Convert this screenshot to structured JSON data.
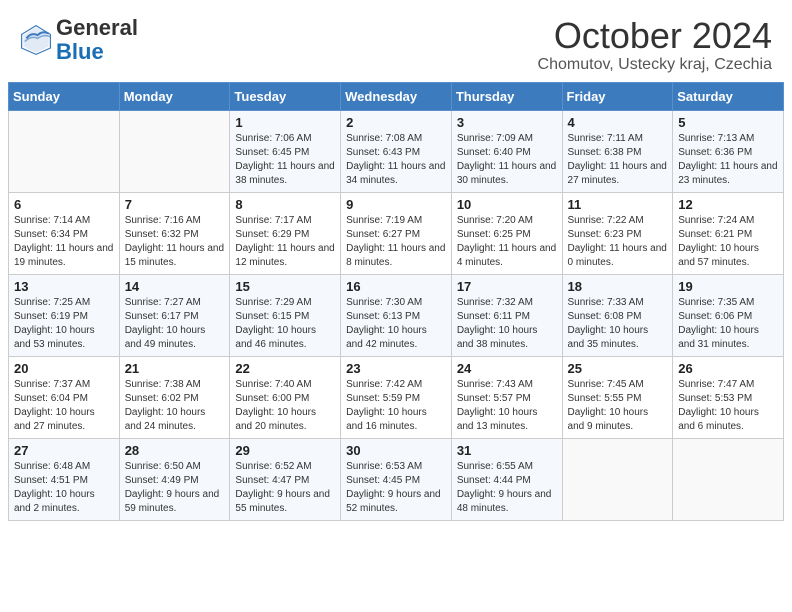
{
  "header": {
    "logo_line1": "General",
    "logo_line2": "Blue",
    "month_title": "October 2024",
    "subtitle": "Chomutov, Ustecky kraj, Czechia"
  },
  "weekdays": [
    "Sunday",
    "Monday",
    "Tuesday",
    "Wednesday",
    "Thursday",
    "Friday",
    "Saturday"
  ],
  "weeks": [
    [
      {
        "day": "",
        "info": ""
      },
      {
        "day": "",
        "info": ""
      },
      {
        "day": "1",
        "info": "Sunrise: 7:06 AM\nSunset: 6:45 PM\nDaylight: 11 hours and 38 minutes."
      },
      {
        "day": "2",
        "info": "Sunrise: 7:08 AM\nSunset: 6:43 PM\nDaylight: 11 hours and 34 minutes."
      },
      {
        "day": "3",
        "info": "Sunrise: 7:09 AM\nSunset: 6:40 PM\nDaylight: 11 hours and 30 minutes."
      },
      {
        "day": "4",
        "info": "Sunrise: 7:11 AM\nSunset: 6:38 PM\nDaylight: 11 hours and 27 minutes."
      },
      {
        "day": "5",
        "info": "Sunrise: 7:13 AM\nSunset: 6:36 PM\nDaylight: 11 hours and 23 minutes."
      }
    ],
    [
      {
        "day": "6",
        "info": "Sunrise: 7:14 AM\nSunset: 6:34 PM\nDaylight: 11 hours and 19 minutes."
      },
      {
        "day": "7",
        "info": "Sunrise: 7:16 AM\nSunset: 6:32 PM\nDaylight: 11 hours and 15 minutes."
      },
      {
        "day": "8",
        "info": "Sunrise: 7:17 AM\nSunset: 6:29 PM\nDaylight: 11 hours and 12 minutes."
      },
      {
        "day": "9",
        "info": "Sunrise: 7:19 AM\nSunset: 6:27 PM\nDaylight: 11 hours and 8 minutes."
      },
      {
        "day": "10",
        "info": "Sunrise: 7:20 AM\nSunset: 6:25 PM\nDaylight: 11 hours and 4 minutes."
      },
      {
        "day": "11",
        "info": "Sunrise: 7:22 AM\nSunset: 6:23 PM\nDaylight: 11 hours and 0 minutes."
      },
      {
        "day": "12",
        "info": "Sunrise: 7:24 AM\nSunset: 6:21 PM\nDaylight: 10 hours and 57 minutes."
      }
    ],
    [
      {
        "day": "13",
        "info": "Sunrise: 7:25 AM\nSunset: 6:19 PM\nDaylight: 10 hours and 53 minutes."
      },
      {
        "day": "14",
        "info": "Sunrise: 7:27 AM\nSunset: 6:17 PM\nDaylight: 10 hours and 49 minutes."
      },
      {
        "day": "15",
        "info": "Sunrise: 7:29 AM\nSunset: 6:15 PM\nDaylight: 10 hours and 46 minutes."
      },
      {
        "day": "16",
        "info": "Sunrise: 7:30 AM\nSunset: 6:13 PM\nDaylight: 10 hours and 42 minutes."
      },
      {
        "day": "17",
        "info": "Sunrise: 7:32 AM\nSunset: 6:11 PM\nDaylight: 10 hours and 38 minutes."
      },
      {
        "day": "18",
        "info": "Sunrise: 7:33 AM\nSunset: 6:08 PM\nDaylight: 10 hours and 35 minutes."
      },
      {
        "day": "19",
        "info": "Sunrise: 7:35 AM\nSunset: 6:06 PM\nDaylight: 10 hours and 31 minutes."
      }
    ],
    [
      {
        "day": "20",
        "info": "Sunrise: 7:37 AM\nSunset: 6:04 PM\nDaylight: 10 hours and 27 minutes."
      },
      {
        "day": "21",
        "info": "Sunrise: 7:38 AM\nSunset: 6:02 PM\nDaylight: 10 hours and 24 minutes."
      },
      {
        "day": "22",
        "info": "Sunrise: 7:40 AM\nSunset: 6:00 PM\nDaylight: 10 hours and 20 minutes."
      },
      {
        "day": "23",
        "info": "Sunrise: 7:42 AM\nSunset: 5:59 PM\nDaylight: 10 hours and 16 minutes."
      },
      {
        "day": "24",
        "info": "Sunrise: 7:43 AM\nSunset: 5:57 PM\nDaylight: 10 hours and 13 minutes."
      },
      {
        "day": "25",
        "info": "Sunrise: 7:45 AM\nSunset: 5:55 PM\nDaylight: 10 hours and 9 minutes."
      },
      {
        "day": "26",
        "info": "Sunrise: 7:47 AM\nSunset: 5:53 PM\nDaylight: 10 hours and 6 minutes."
      }
    ],
    [
      {
        "day": "27",
        "info": "Sunrise: 6:48 AM\nSunset: 4:51 PM\nDaylight: 10 hours and 2 minutes."
      },
      {
        "day": "28",
        "info": "Sunrise: 6:50 AM\nSunset: 4:49 PM\nDaylight: 9 hours and 59 minutes."
      },
      {
        "day": "29",
        "info": "Sunrise: 6:52 AM\nSunset: 4:47 PM\nDaylight: 9 hours and 55 minutes."
      },
      {
        "day": "30",
        "info": "Sunrise: 6:53 AM\nSunset: 4:45 PM\nDaylight: 9 hours and 52 minutes."
      },
      {
        "day": "31",
        "info": "Sunrise: 6:55 AM\nSunset: 4:44 PM\nDaylight: 9 hours and 48 minutes."
      },
      {
        "day": "",
        "info": ""
      },
      {
        "day": "",
        "info": ""
      }
    ]
  ]
}
